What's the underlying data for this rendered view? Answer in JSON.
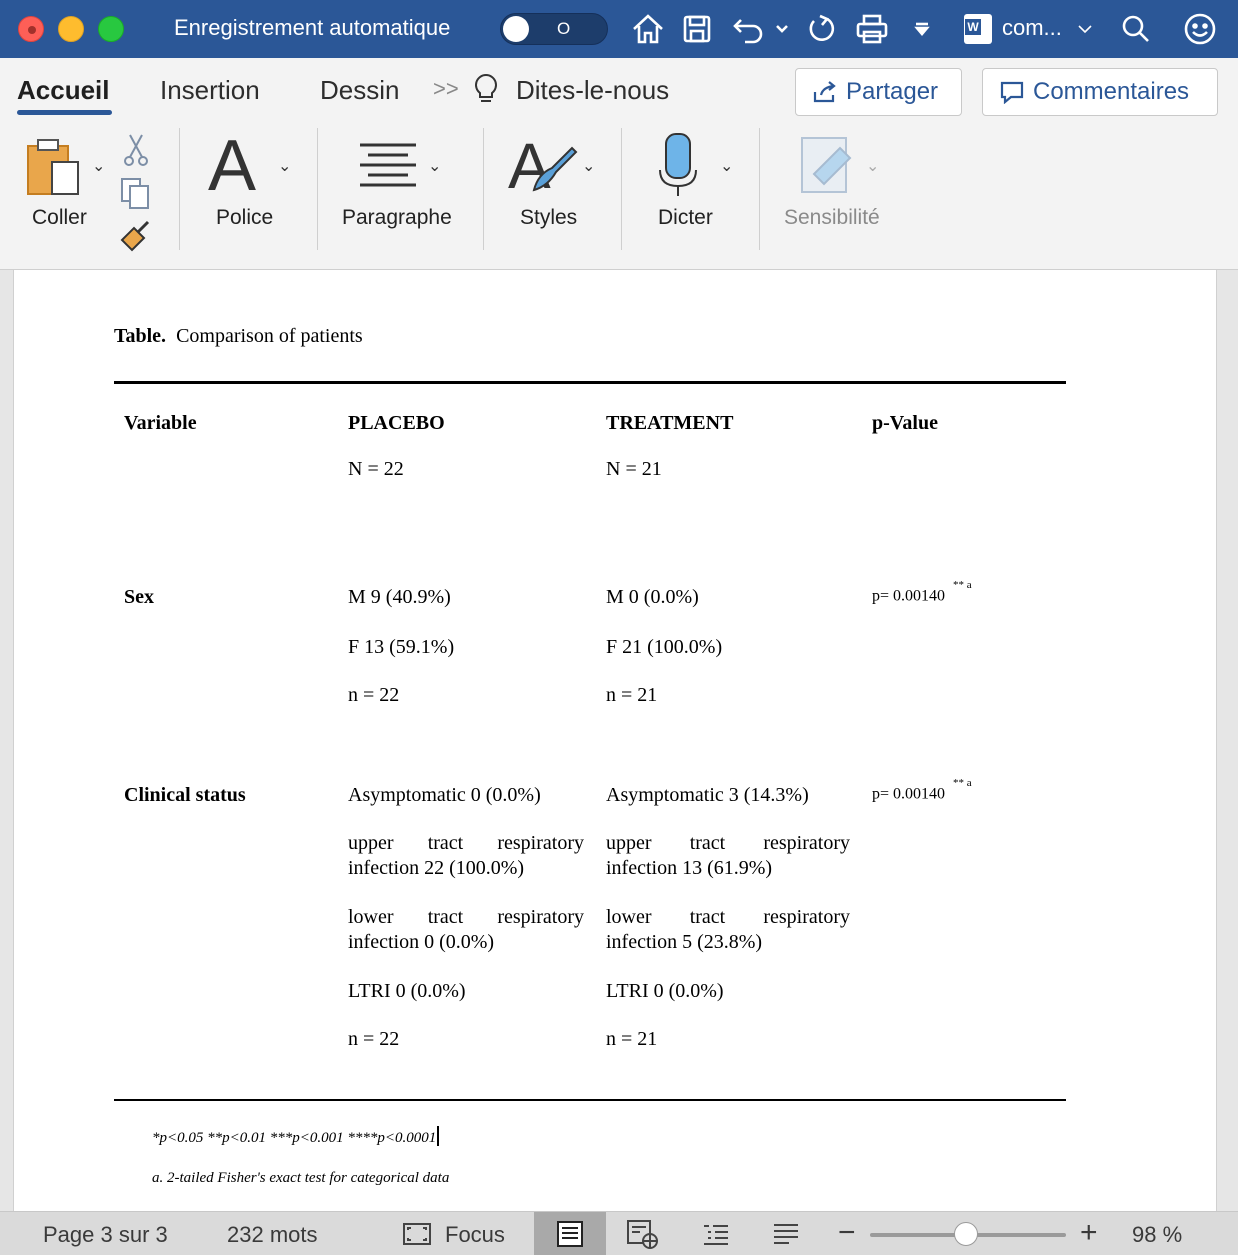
{
  "titlebar": {
    "autosave_label": "Enregistrement automatique",
    "autosave_state": "O",
    "doc_name": "com...",
    "word_badge": "W"
  },
  "tabs": {
    "accueil": "Accueil",
    "insertion": "Insertion",
    "dessin": "Dessin",
    "more": ">>",
    "tell_me": "Dites-le-nous"
  },
  "actions": {
    "share": "Partager",
    "comments": "Commentaires"
  },
  "ribbon_groups": {
    "coller": "Coller",
    "police": "Police",
    "paragraphe": "Paragraphe",
    "styles": "Styles",
    "dicter": "Dicter",
    "sensibilite": "Sensibilité"
  },
  "document": {
    "table_title_bold": "Table.",
    "table_title_text": "Comparison of patients",
    "headers": {
      "variable": "Variable",
      "placebo": "PLACEBO",
      "treatment": "TREATMENT",
      "pvalue": "p-Value"
    },
    "n_placebo": "N = 22",
    "n_treatment": "N = 21",
    "sex": {
      "label": "Sex",
      "placebo_m": "M 9 (40.9%)",
      "placebo_f": "F 13 (59.1%)",
      "placebo_n": "n = 22",
      "treatment_m": "M 0 (0.0%)",
      "treatment_f": "F 21 (100.0%)",
      "treatment_n": "n = 21",
      "pvalue": "p= 0.00140",
      "pvalue_sup": "** a"
    },
    "clinical": {
      "label": "Clinical status",
      "placebo_asym": "Asymptomatic 0 (0.0%)",
      "placebo_upper_l1": [
        "upper",
        "tract",
        "respiratory"
      ],
      "placebo_upper_l2": "infection 22 (100.0%)",
      "placebo_lower_l1": [
        "lower",
        "tract",
        "respiratory"
      ],
      "placebo_lower_l2": "infection 0 (0.0%)",
      "placebo_ltri": "LTRI 0 (0.0%)",
      "placebo_n": "n = 22",
      "treatment_asym": "Asymptomatic 3 (14.3%)",
      "treatment_upper_l1": [
        "upper",
        "tract",
        "respiratory"
      ],
      "treatment_upper_l2": "infection 13 (61.9%)",
      "treatment_lower_l1": [
        "lower",
        "tract",
        "respiratory"
      ],
      "treatment_lower_l2": "infection 5 (23.8%)",
      "treatment_ltri": "LTRI 0 (0.0%)",
      "treatment_n": "n = 21",
      "pvalue": "p= 0.00140",
      "pvalue_sup": "** a"
    },
    "footnote_sig": "*p<0.05 **p<0.01 ***p<0.001 ****p<0.0001",
    "footnote_a": "a. 2-tailed Fisher's exact test for categorical data"
  },
  "statusbar": {
    "page": "Page 3 sur 3",
    "words": "232 mots",
    "focus": "Focus",
    "zoom": "98 %",
    "zoom_level_percent": 98
  },
  "colors": {
    "titlebar": "#2b5797",
    "accent": "#2b5797"
  }
}
